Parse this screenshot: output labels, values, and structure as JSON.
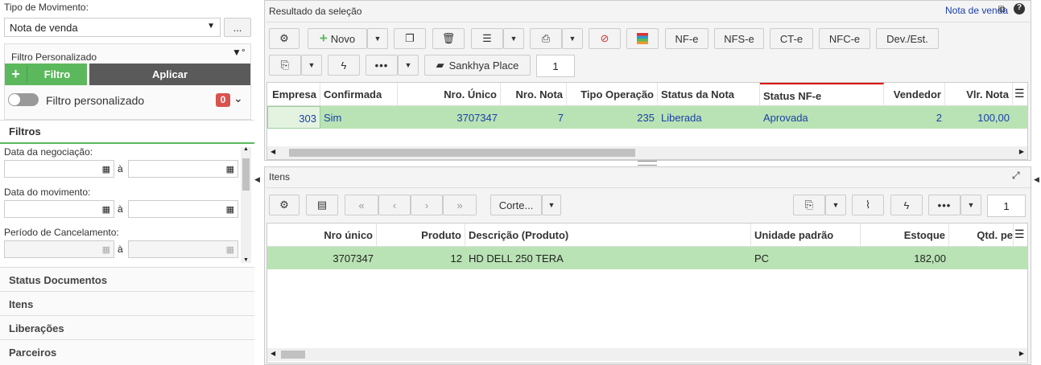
{
  "left": {
    "tipo_label": "Tipo de Movimento:",
    "tipo_value": "Nota de venda",
    "more": "...",
    "filtro_pers_title": "Filtro Personalizado",
    "filtro_btn": "Filtro",
    "aplicar_btn": "Aplicar",
    "filtro_toggle_label": "Filtro personalizado",
    "filtro_count": "0",
    "filtros_title": "Filtros",
    "date1_label": "Data da negociação:",
    "date2_label": "Data do movimento:",
    "date3_label": "Período de Cancelamento:",
    "a": "à",
    "sections": [
      "Status Documentos",
      "Itens",
      "Liberações",
      "Parceiros"
    ]
  },
  "top": {
    "title": "Resultado da seleção",
    "link": "Nota de venda",
    "novo": "Novo",
    "nfe": "NF-e",
    "nfse": "NFS-e",
    "cte": "CT-e",
    "nfce": "NFC-e",
    "dev": "Dev./Est.",
    "sankhya": "Sankhya Place",
    "page": "1",
    "headers": [
      "Empresa",
      "Confirmada",
      "Nro. Único",
      "Nro. Nota",
      "Tipo Operação",
      "Status da Nota",
      "Status NF-e",
      "Vendedor",
      "Vlr. Nota"
    ],
    "row": [
      "303",
      "Sim",
      "3707347",
      "7",
      "235",
      "Liberada",
      "Aprovada",
      "2",
      "100,00"
    ]
  },
  "items": {
    "title": "Itens",
    "corte": "Corte...",
    "page": "1",
    "headers": [
      "Nro único",
      "Produto",
      "Descrição (Produto)",
      "Unidade padrão",
      "Estoque",
      "Qtd. pe"
    ],
    "row": [
      "3707347",
      "12",
      "HD DELL 250 TERA",
      "PC",
      "182,00",
      ""
    ]
  },
  "colors": {
    "accent": "#5cb85c",
    "dark_btn": "#5a5a5a",
    "row_bg": "#b9e3b4",
    "badge": "#d9534f",
    "link": "#1a3faa"
  }
}
